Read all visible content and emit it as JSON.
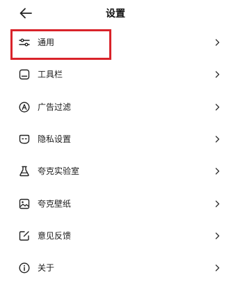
{
  "header": {
    "title": "设置",
    "back_icon": "arrow-left-icon"
  },
  "items": [
    {
      "label": "通用",
      "icon": "sliders-icon"
    },
    {
      "label": "工具栏",
      "icon": "toolbar-icon"
    },
    {
      "label": "广告过滤",
      "icon": "ad-filter-icon"
    },
    {
      "label": "隐私设置",
      "icon": "privacy-mask-icon"
    },
    {
      "label": "夸克实验室",
      "icon": "flask-icon"
    },
    {
      "label": "夸克壁纸",
      "icon": "image-icon"
    },
    {
      "label": "意见反馈",
      "icon": "edit-feedback-icon"
    },
    {
      "label": "关于",
      "icon": "info-icon"
    }
  ],
  "highlight": {
    "target": "通用",
    "color": "#d9232a"
  },
  "colors": {
    "text": "#1a1a1a",
    "icon": "#222222",
    "chevron": "#333333"
  }
}
